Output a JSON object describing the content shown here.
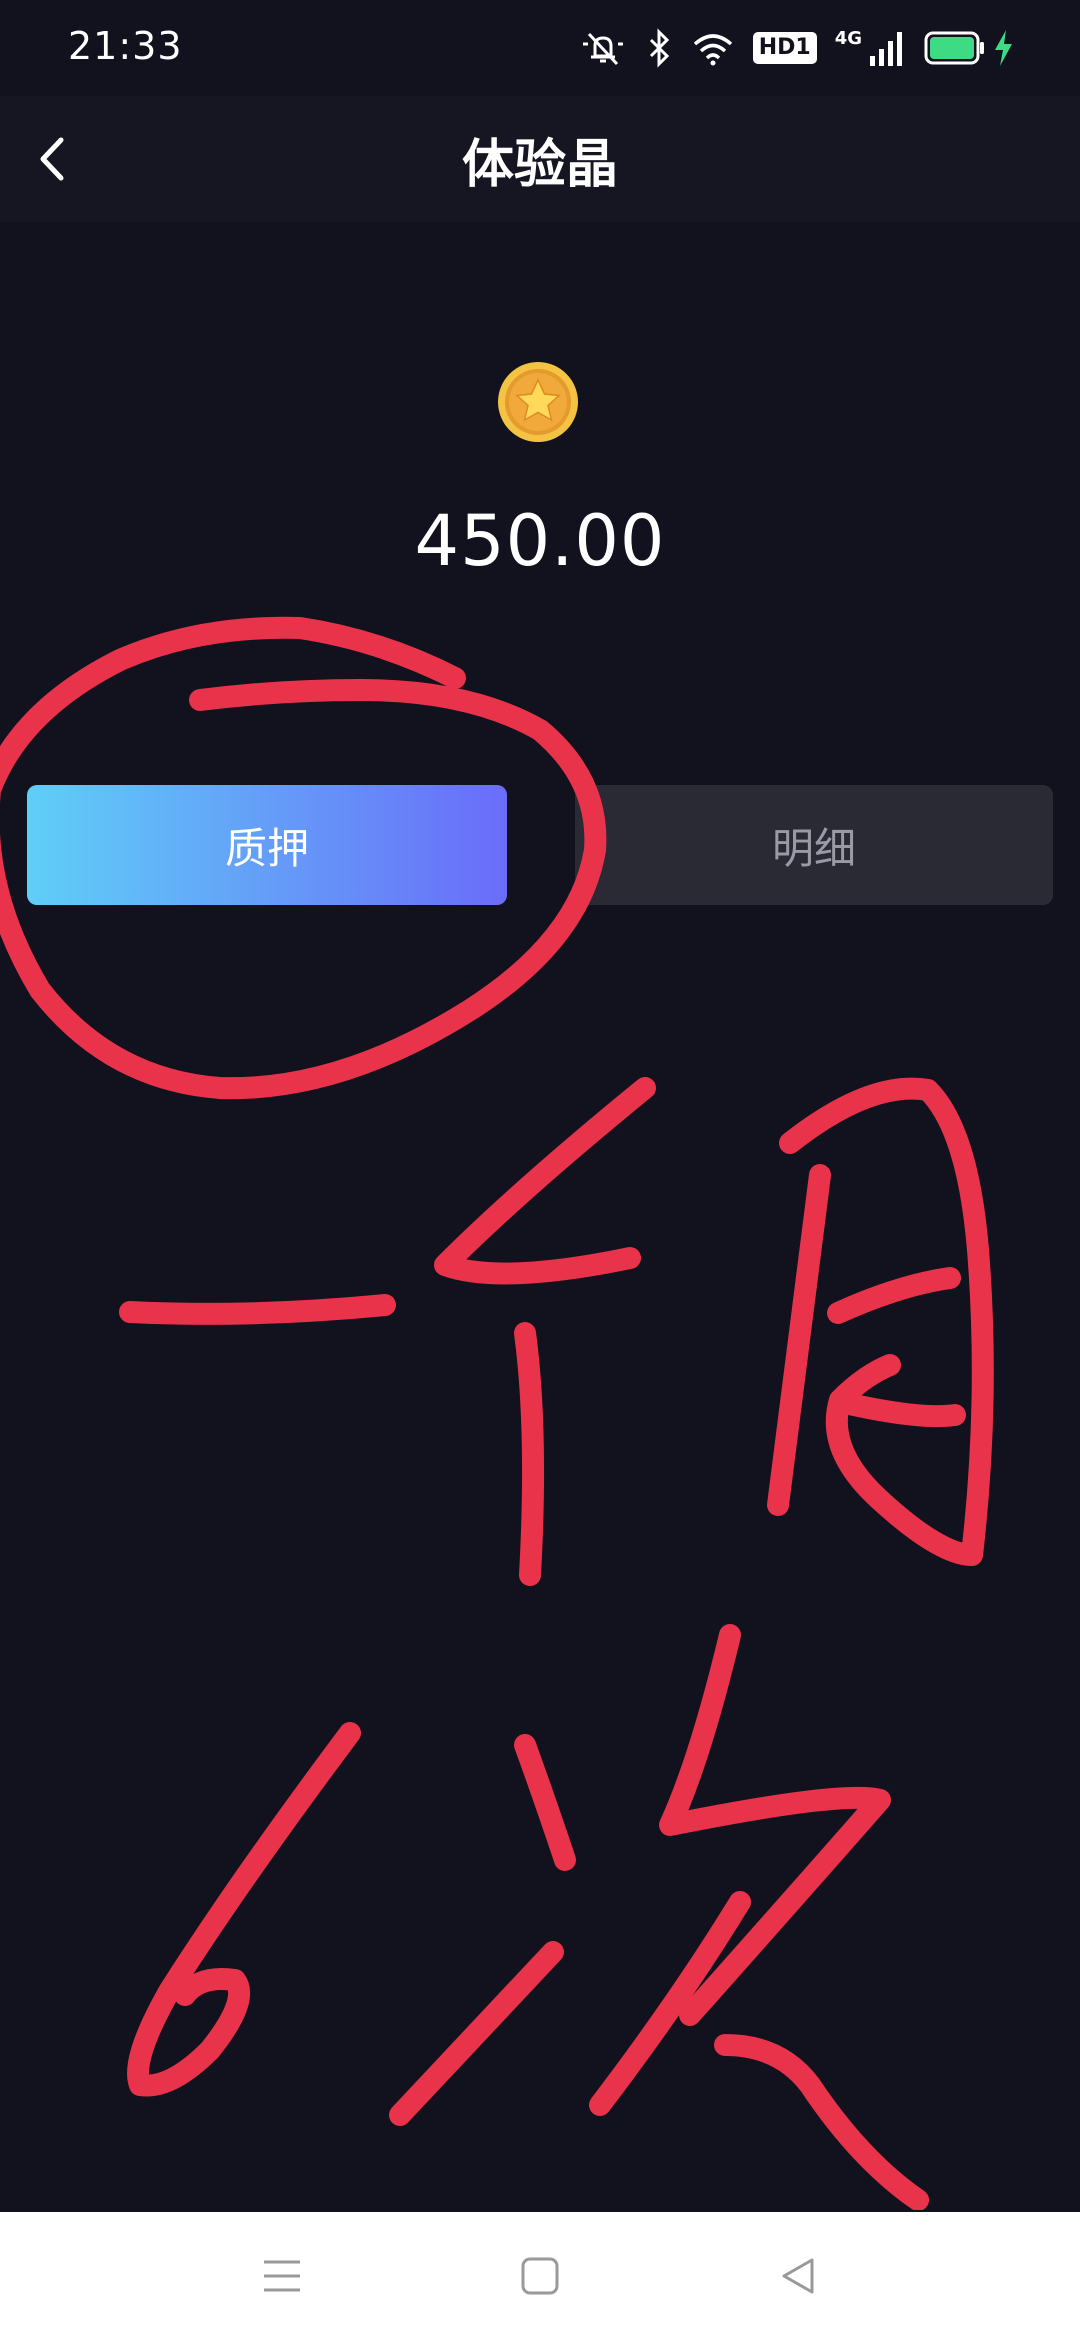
{
  "status_bar": {
    "time": "21:33",
    "hd_label": "HD1",
    "network_label": "4G",
    "icons": [
      "mute-icon",
      "bluetooth-icon",
      "wifi-icon",
      "hd-icon",
      "signal-icon",
      "battery-icon",
      "charging-icon"
    ]
  },
  "header": {
    "title": "体验晶",
    "back_icon": "chevron-left-icon"
  },
  "balance": {
    "icon": "coin-star-icon",
    "amount": "450.00"
  },
  "actions": {
    "pledge_label": "质押",
    "detail_label": "明细"
  },
  "annotation": {
    "handwriting": "一个月6次",
    "color": "#e8334a"
  },
  "nav_bar": {
    "icons": [
      "menu-icon",
      "home-icon",
      "back-triangle-icon"
    ]
  },
  "colors": {
    "background": "#12111e",
    "header": "#161522",
    "gradient_start": "#5fcff7",
    "gradient_end": "#6a6cf9",
    "secondary_button": "#2a2a35",
    "battery": "#3ddc84"
  }
}
